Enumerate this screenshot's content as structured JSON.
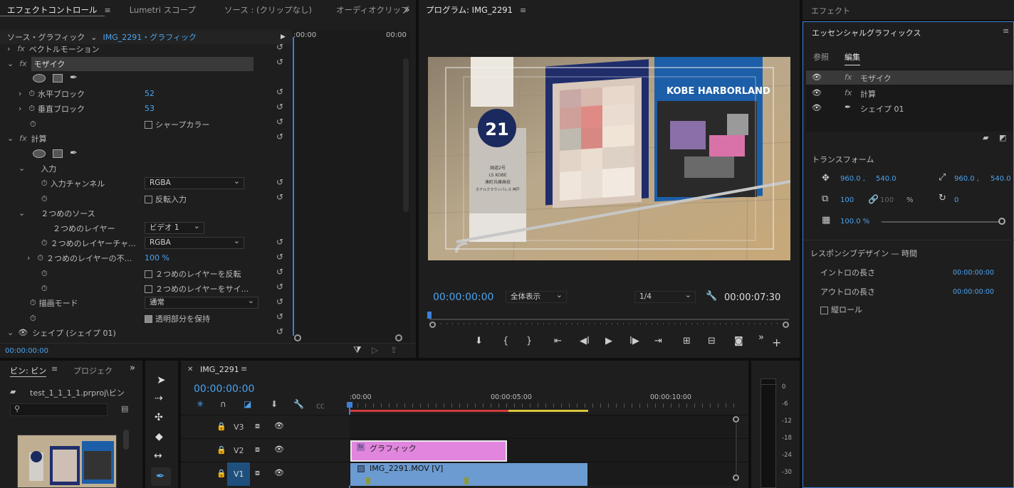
{
  "effect_controls": {
    "tabs": [
      "エフェクトコントロール",
      "Lumetri スコープ",
      "ソース : (クリップなし)",
      "オーディオクリップ"
    ],
    "menu_icon": "≡",
    "more": "»",
    "source_label": "ソース・グラフィック",
    "clip_label": "IMG_2291・グラフィック",
    "time_start": ":00:00",
    "time_end": "00:00",
    "vector_motion": "ベクトルモーション",
    "mosaic": "モザイク",
    "h_block": "水平ブロック",
    "h_block_val": "52",
    "v_block": "垂直ブロック",
    "v_block_val": "53",
    "sharp_color": "シャープカラー",
    "calc": "計算",
    "input": "入力",
    "input_channel": "入力チャンネル",
    "input_channel_val": "RGBA",
    "invert_input": "反転入力",
    "second_source": "２つめのソース",
    "second_layer": "２つめのレイヤー",
    "second_layer_val": "ビデオ 1",
    "second_layer_channel": "２つめのレイヤーチャ...",
    "second_layer_channel_val": "RGBA",
    "second_layer_opacity": "２つめのレイヤーの不...",
    "second_layer_opacity_val": "100 %",
    "invert_second": "２つめのレイヤーを反転",
    "second_size": "２つめのレイヤーをサイ...",
    "blend_mode": "描画モード",
    "blend_mode_val": "通常",
    "preserve_alpha": "透明部分を保持",
    "shape": "シェイプ (シェイプ 01)",
    "timecode": "00:00:00:00",
    "fx": "fx"
  },
  "program": {
    "title": "プログラム: IMG_2291",
    "timecode": "00:00:00:00",
    "zoom": "全体表示",
    "resolution": "1/4",
    "duration": "00:00:07:30",
    "sign_brand": "KOBE HARBORLAND",
    "sign_number": "21",
    "sign_text": [
      "国道2号",
      "LS KOBE",
      "湊町兵庫高校",
      "ホテルクラウンパレス 神戸"
    ]
  },
  "essential_graphics": {
    "effects_tab": "エフェクト",
    "title": "エッセンシャルグラフィックス",
    "tab_browse": "参照",
    "tab_edit": "編集",
    "layers": [
      "モザイク",
      "計算",
      "シェイプ 01"
    ],
    "transform": "トランスフォーム",
    "pos_x": "960.0 ,",
    "pos_y": "540.0",
    "anchor_x": "960.0 ,",
    "anchor_y": "540.0",
    "scale": "100",
    "scale2": "100",
    "percent": "%",
    "rotation": "0",
    "opacity": "100.0 %",
    "responsive": "レスポンシブデザイン — 時間",
    "intro": "イントロの長さ",
    "intro_val": "00:00:00:00",
    "outro": "アウトロの長さ",
    "outro_val": "00:00:00:00",
    "roll": "縦ロール"
  },
  "project": {
    "tab_bin": "ビン: ビン",
    "tab_project": "プロジェク",
    "path": "test_1_1_1_1.prproj\\ビン"
  },
  "timeline": {
    "seq_name": "IMG_2291",
    "timecode": "00:00:00:00",
    "ruler": [
      ":00:00",
      "00:00:05:00",
      "00:00:10:00"
    ],
    "tracks": [
      "V3",
      "V2",
      "V1"
    ],
    "clip_graphic": "グラフィック",
    "clip_video": "IMG_2291.MOV [V]"
  },
  "audio_meter": {
    "labels": [
      "0",
      "-6",
      "-12",
      "-18",
      "-24",
      "-30"
    ]
  }
}
